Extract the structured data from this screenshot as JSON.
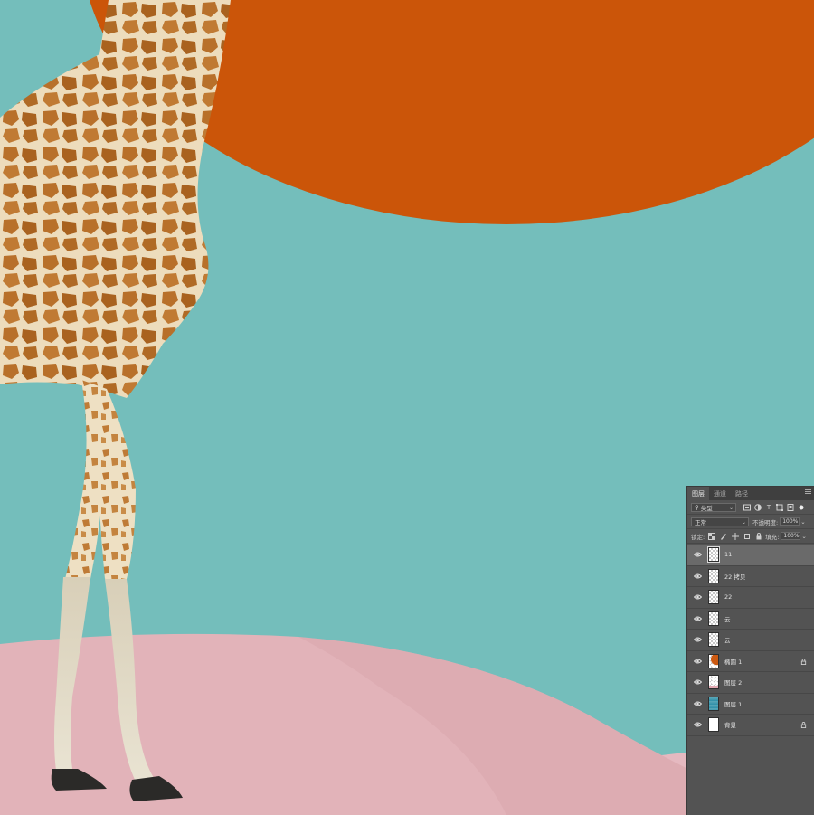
{
  "colors": {
    "sky": "#74bebb",
    "sun": "#cb5509",
    "dune": "#e3b4ba",
    "dune_shadow": "#d9a3ab",
    "giraffe_base": "#efe0c0",
    "giraffe_spot": "#b8702a",
    "panel_bg": "#535353"
  },
  "layers_panel": {
    "tabs": [
      {
        "label": "图层",
        "active": true
      },
      {
        "label": "通道",
        "active": false
      },
      {
        "label": "路径",
        "active": false
      }
    ],
    "filter": {
      "kind_label": "类型",
      "icons": [
        "image-filter-icon",
        "adjustment-filter-icon",
        "type-filter-icon",
        "shape-filter-icon",
        "smartobject-filter-icon"
      ]
    },
    "blend_mode": "正常",
    "opacity_label": "不透明度:",
    "opacity_value": "100%",
    "lock_label": "锁定:",
    "fill_label": "填充:",
    "fill_value": "100%",
    "layers": [
      {
        "name": "11",
        "thumb": "transparent",
        "selected": true,
        "locked": false
      },
      {
        "name": "22 拷贝",
        "thumb": "transparent",
        "selected": false,
        "locked": false
      },
      {
        "name": "22",
        "thumb": "transparent",
        "selected": false,
        "locked": false
      },
      {
        "name": "云",
        "thumb": "transparent",
        "selected": false,
        "locked": false
      },
      {
        "name": "云",
        "thumb": "transparent",
        "selected": false,
        "locked": false
      },
      {
        "name": "椭圆 1",
        "thumb": "orange",
        "selected": false,
        "locked": true
      },
      {
        "name": "图层 2",
        "thumb": "pinkish",
        "selected": false,
        "locked": false
      },
      {
        "name": "图层 1",
        "thumb": "grad",
        "selected": false,
        "locked": false
      },
      {
        "name": "背景",
        "thumb": "white",
        "selected": false,
        "locked": true
      }
    ]
  }
}
